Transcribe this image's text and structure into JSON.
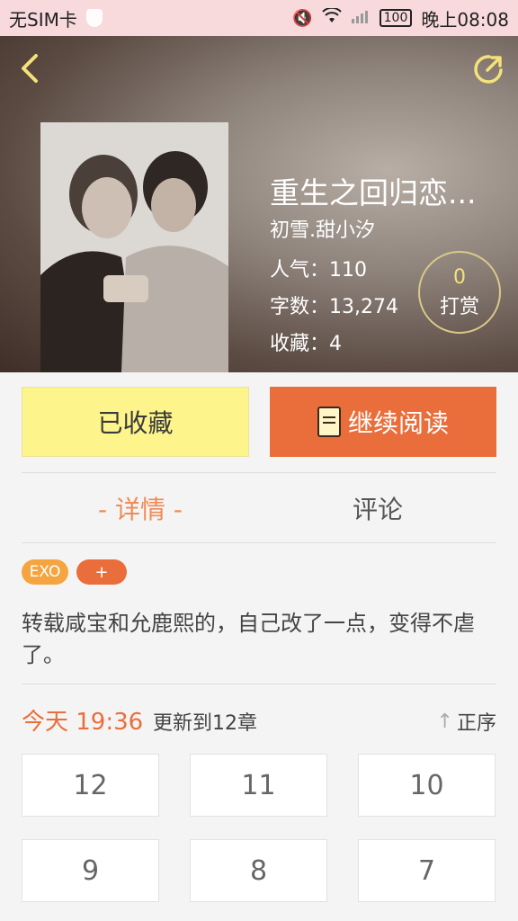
{
  "status_bar": {
    "carrier": "无SIM卡",
    "battery": "100",
    "time": "晚上08:08"
  },
  "book": {
    "title": "重生之回归恋...",
    "author": "初雪.甜小汐",
    "popularity": "人气：110",
    "word_count": "字数：13,274",
    "favorites": "收藏：4",
    "reward_count": "0",
    "reward_label": "打赏"
  },
  "actions": {
    "favorited_label": "已收藏",
    "continue_label": "继续阅读"
  },
  "tabs": {
    "detail": "- 详情 -",
    "comments": "评论"
  },
  "tags": [
    "EXO",
    "+"
  ],
  "description": "转载咸宝和允鹿熙的，自己改了一点，变得不虐了。",
  "update": {
    "time": "今天 19:36",
    "text": "更新到12章",
    "sort_label": "正序"
  },
  "chapters": [
    "12",
    "11",
    "10",
    "9",
    "8",
    "7"
  ],
  "colors": {
    "accent": "#ea6e3b",
    "favorite_button": "#fdf48b",
    "tag_exo": "#f5a540",
    "status_bar": "#f8d9dc"
  },
  "icons": [
    "back-arrow-icon",
    "share-icon",
    "book-icon",
    "sort-up-arrow-icon",
    "mute-icon",
    "wifi-icon",
    "signal-icon",
    "battery-icon",
    "shield-icon"
  ]
}
